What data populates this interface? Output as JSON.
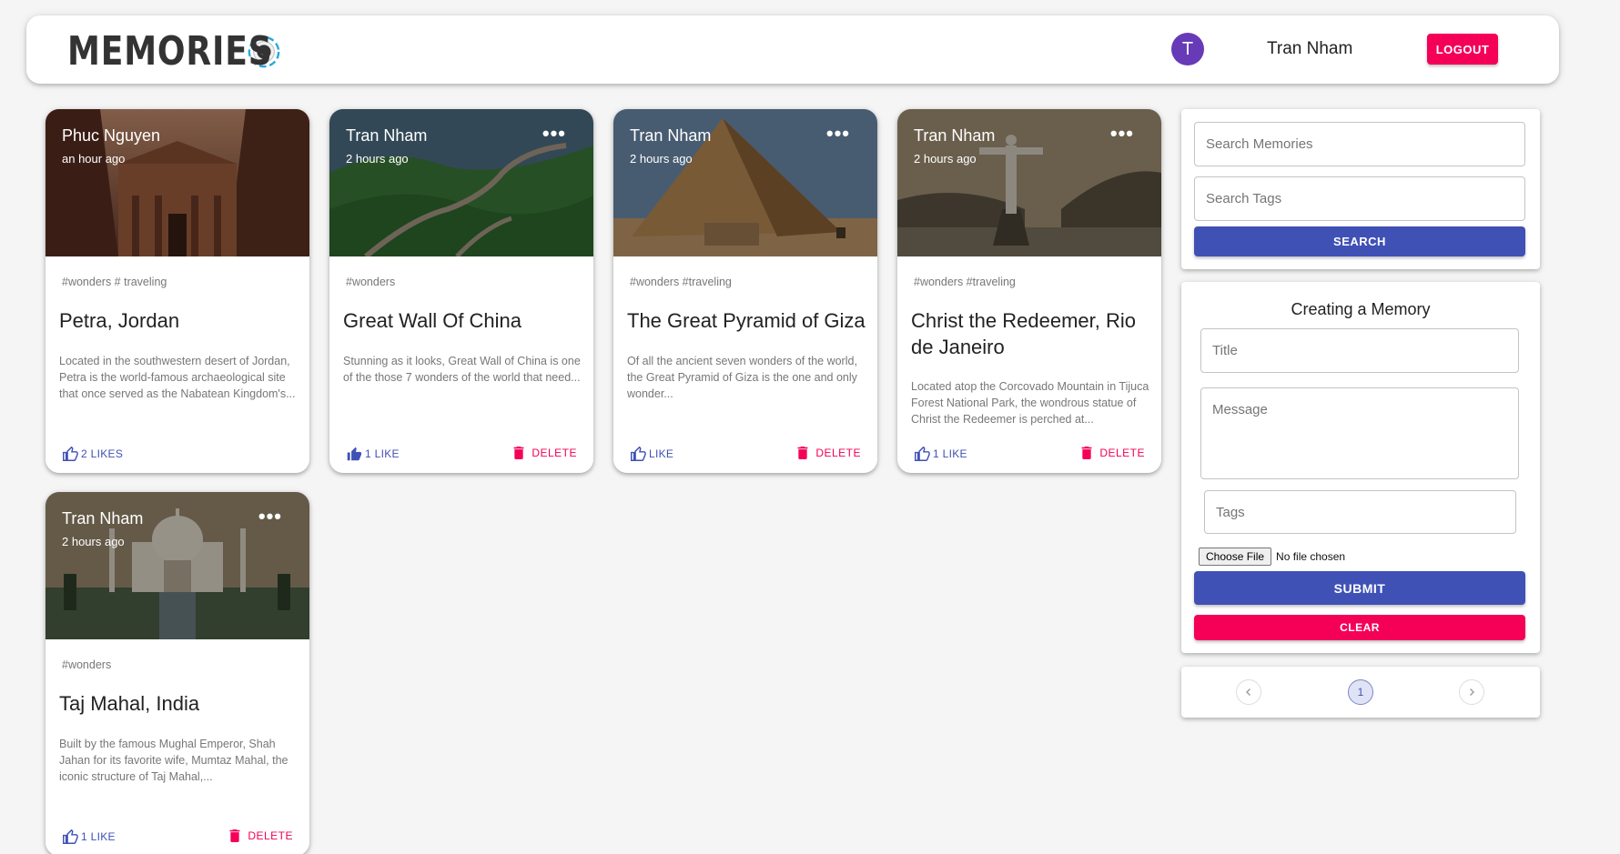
{
  "header": {
    "brand": "MEMORIES",
    "avatar_initial": "T",
    "user_name": "Tran Nham",
    "logout_label": "LOGOUT"
  },
  "posts": [
    {
      "author": "Phuc Nguyen",
      "time": "an hour ago",
      "tags": "#wonders # traveling",
      "title": "Petra, Jordan",
      "message": "Located in the southwestern desert of Jordan, Petra is the world-famous archaeological site that once served as the Nabatean Kingdom's...",
      "like_label": "2 LIKES",
      "has_menu": false,
      "delete_label": ""
    },
    {
      "author": "Tran Nham",
      "time": "2 hours ago",
      "tags": "#wonders",
      "title": "Great Wall Of China",
      "message": "Stunning as it looks, Great Wall of China is one of the those 7 wonders of the world that need...",
      "like_label": "1 LIKE",
      "has_menu": true,
      "delete_label": "DELETE"
    },
    {
      "author": "Tran Nham",
      "time": "2 hours ago",
      "tags": "#wonders #traveling",
      "title": "The Great Pyramid of Giza",
      "message": "Of all the ancient seven wonders of the world, the Great Pyramid of Giza is the one and only wonder...",
      "like_label": "LIKE",
      "has_menu": true,
      "delete_label": "DELETE"
    },
    {
      "author": "Tran Nham",
      "time": "2 hours ago",
      "tags": "#wonders #traveling",
      "title": "Christ the Redeemer, Rio de Janeiro",
      "message": "Located atop the Corcovado Mountain in Tijuca Forest National Park, the wondrous statue of Christ the Redeemer is perched at...",
      "like_label": "1 LIKE",
      "has_menu": true,
      "delete_label": "DELETE"
    },
    {
      "author": "Tran Nham",
      "time": "2 hours ago",
      "tags": "#wonders",
      "title": "Taj Mahal, India",
      "message": "Built by the famous Mughal Emperor, Shah Jahan for its favorite wife, Mumtaz Mahal, the iconic structure of Taj Mahal,...",
      "like_label": "1 LIKE",
      "has_menu": true,
      "delete_label": "DELETE"
    }
  ],
  "search": {
    "memories_placeholder": "Search Memories",
    "tags_placeholder": "Search Tags",
    "button_label": "SEARCH"
  },
  "form": {
    "heading": "Creating a Memory",
    "title_placeholder": "Title",
    "message_placeholder": "Message",
    "tags_placeholder": "Tags",
    "file_button": "Choose File",
    "file_status": "No file chosen",
    "submit_label": "SUBMIT",
    "clear_label": "CLEAR"
  },
  "pagination": {
    "prev_icon": "chevron-left-icon",
    "current_page": "1",
    "next_icon": "chevron-right-icon"
  },
  "colors": {
    "primary": "#3f51b5",
    "secondary": "#f50057",
    "avatar": "#673ab7"
  }
}
